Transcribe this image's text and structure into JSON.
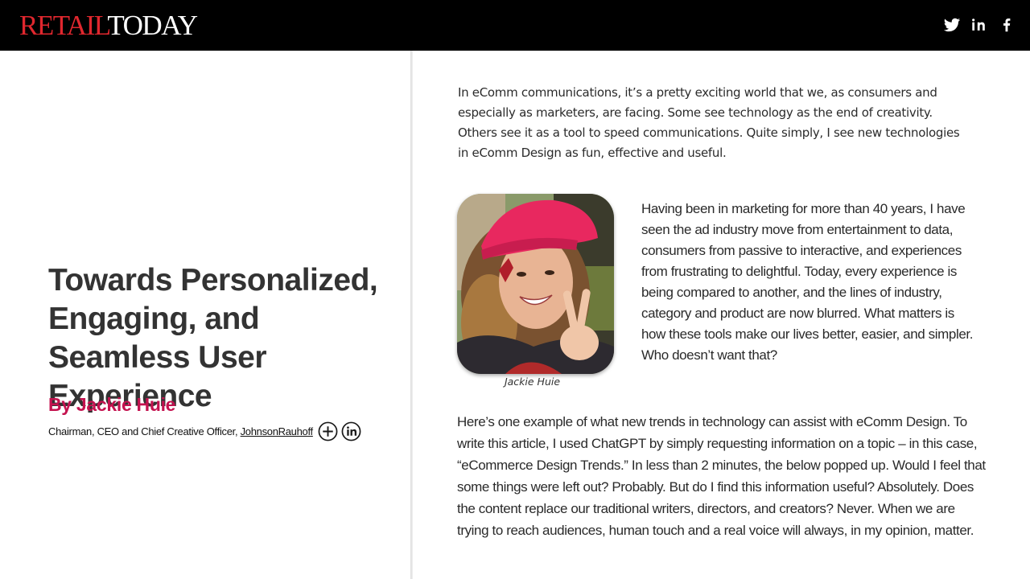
{
  "header": {
    "logo": {
      "part1": "RETAIL",
      "part2": "TODAY"
    },
    "social_icons": [
      "twitter-icon",
      "linkedin-icon",
      "facebook-icon"
    ]
  },
  "article": {
    "title": "Towards Personalized, Engaging, and Seamless User Experience",
    "byline": "By Jackie Huie",
    "author_role": "Chairman, CEO and Chief Creative Officer, ",
    "author_company": "JohnsonRauhoff",
    "author_icons": [
      "plus-circle-icon",
      "linkedin-circle-icon"
    ],
    "intro": "In eComm communications, it’s a pretty exciting world that we, as consumers and especially as marketers, are facing. Some see technology as the end of creativity. Others see it as a tool to speed communications. Quite simply, I see new technologies in eComm Design as fun, effective and useful.",
    "photo_caption": "Jackie Huie",
    "paragraph_2": "Having been in marketing for more than 40 years, I have seen the ad industry move from entertainment to data, consumers from passive to interactive, and experiences from frustrating to delightful. Today, every experience is being compared to another, and the lines of industry, category and product are now blurred. What matters is how these tools make our lives better, easier, and simpler. Who doesn’t want that?",
    "paragraph_3": "Here’s one example of what new trends in technology can assist with eComm Design. To write this article, I used ChatGPT by simply requesting information on a topic – in this case, “eCommerce Design Trends.” In less than 2 minutes, the below popped up. Would I feel that some things were left out? Probably. But do I find this information useful? Absolutely. Does the content replace our traditional writers, directors, and creators? Never. When we are trying to reach audiences, human touch and a real voice will always, in my opinion, matter."
  },
  "colors": {
    "header_bg": "#000000",
    "logo_red": "#e0272e",
    "byline": "#c4124f",
    "title": "#333333"
  }
}
